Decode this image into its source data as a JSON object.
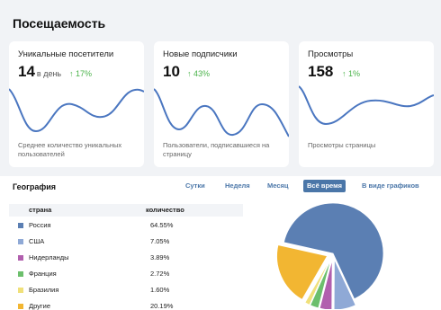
{
  "page": {
    "title": "Посещаемость"
  },
  "cards": [
    {
      "title": "Уникальные посетители",
      "value": "14",
      "unit": "в день",
      "delta": "↑ 17%",
      "description": "Среднее количество уникальных пользователей"
    },
    {
      "title": "Новые подписчики",
      "value": "10",
      "unit": "",
      "delta": "↑ 43%",
      "description": "Пользователи, подписавшиеся на страницу"
    },
    {
      "title": "Просмотры",
      "value": "158",
      "unit": "",
      "delta": "↑ 1%",
      "description": "Просмотры страницы"
    }
  ],
  "geography": {
    "title": "География",
    "tabs": [
      {
        "label": "Сутки",
        "active": false
      },
      {
        "label": "Неделя",
        "active": false
      },
      {
        "label": "Месяц",
        "active": false
      },
      {
        "label": "Всё время",
        "active": true
      },
      {
        "label": "В виде графиков",
        "active": false
      }
    ],
    "columns": {
      "country": "страна",
      "value": "количество"
    },
    "rows": [
      {
        "country": "Россия",
        "value": "64.55%",
        "color": "#5b7fb3"
      },
      {
        "country": "США",
        "value": "7.05%",
        "color": "#8fa9d6"
      },
      {
        "country": "Нидерланды",
        "value": "3.89%",
        "color": "#b15fae"
      },
      {
        "country": "Франция",
        "value": "2.72%",
        "color": "#6cbf6c"
      },
      {
        "country": "Бразилия",
        "value": "1.60%",
        "color": "#f0e07a"
      },
      {
        "country": "Другие",
        "value": "20.19%",
        "color": "#f2b632"
      }
    ]
  },
  "chart_data": {
    "type": "pie",
    "categories": [
      "Россия",
      "США",
      "Нидерланды",
      "Франция",
      "Бразилия",
      "Другие"
    ],
    "values": [
      64.55,
      7.05,
      3.89,
      2.72,
      1.6,
      20.19
    ],
    "colors": [
      "#5b7fb3",
      "#8fa9d6",
      "#b15fae",
      "#6cbf6c",
      "#f0e07a",
      "#f2b632"
    ],
    "exploded_categories": [
      "США",
      "Нидерланды",
      "Франция",
      "Бразилия",
      "Другие"
    ]
  },
  "colors": {
    "accent": "#4a76a8",
    "positive": "#4bb34b",
    "line": "#4a76c0",
    "background": "#f1f3f6"
  }
}
